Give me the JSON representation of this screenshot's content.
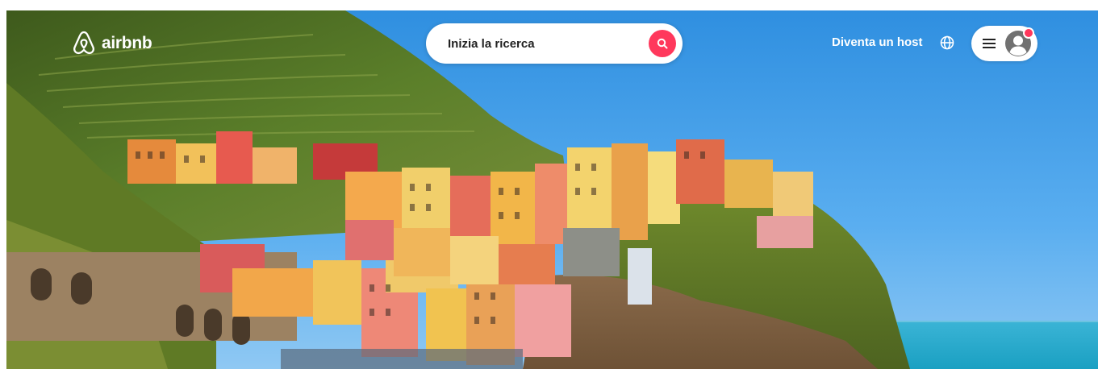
{
  "header": {
    "logo_text": "airbnb",
    "search": {
      "placeholder": "Inizia la ricerca",
      "button_color": "#FF385C"
    },
    "host_link": "Diventa un host",
    "language_icon": "globe-icon",
    "menu_icon": "hamburger-menu-icon",
    "avatar_icon": "user-avatar-icon",
    "notification_color": "#FF385C"
  },
  "hero": {
    "image_subject": "Cinque Terre cliffside village by the sea"
  },
  "colors": {
    "brand": "#FF385C",
    "sky": "#4AA3E6",
    "sea": "#2AA8C8"
  }
}
